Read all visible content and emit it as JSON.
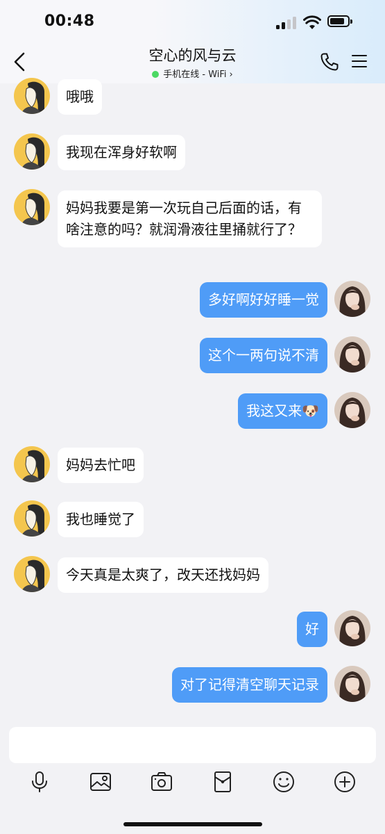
{
  "status_bar": {
    "time": "00:48"
  },
  "header": {
    "title": "空心的风与云",
    "online_status": "手机在线 - WiFi",
    "back_icon": "chevron-left-icon",
    "call_icon": "phone-icon",
    "menu_icon": "menu-icon"
  },
  "messages": [
    {
      "side": "in",
      "text": "哦哦"
    },
    {
      "side": "in",
      "text": "我现在浑身好软啊"
    },
    {
      "side": "in",
      "text": "妈妈我要是第一次玩自己后面的话，有啥注意的吗？就润滑液往里捅就行了？"
    },
    {
      "side": "out",
      "text": "多好啊好好睡一觉"
    },
    {
      "side": "out",
      "text": "这个一两句说不清"
    },
    {
      "side": "out",
      "text": "我这又来🐶"
    },
    {
      "side": "in",
      "text": "妈妈去忙吧"
    },
    {
      "side": "in",
      "text": "我也睡觉了"
    },
    {
      "side": "in",
      "text": "今天真是太爽了，改天还找妈妈"
    },
    {
      "side": "out",
      "text": "好"
    },
    {
      "side": "out",
      "text": "对了记得清空聊天记录"
    }
  ],
  "composer": {
    "input_value": "",
    "tools": [
      "microphone-icon",
      "image-icon",
      "camera-icon",
      "red-packet-icon",
      "emoji-icon",
      "plus-icon"
    ]
  },
  "colors": {
    "outgoing_bubble": "#4f9cf7",
    "incoming_bubble": "#ffffff",
    "background": "#f2f2f5",
    "online_dot": "#4cd964"
  }
}
